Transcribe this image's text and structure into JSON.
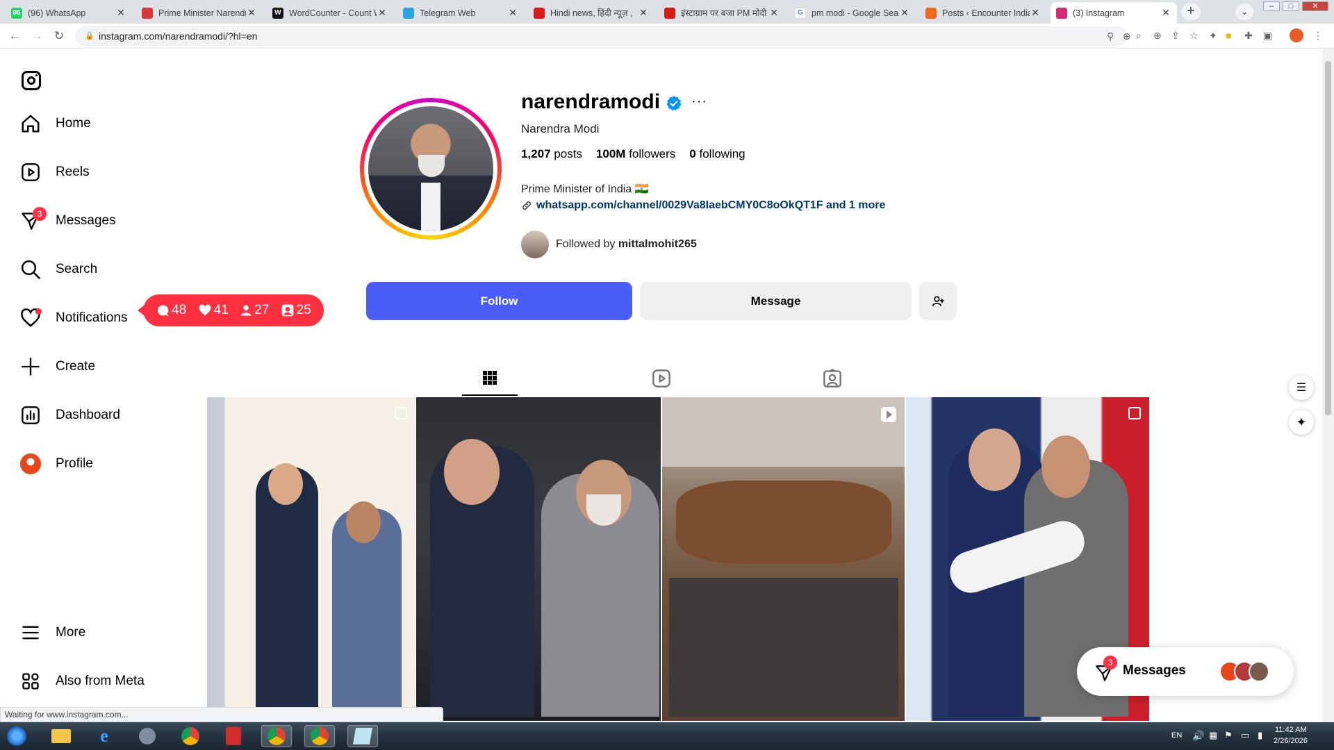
{
  "browser": {
    "tabs": [
      {
        "title": "(96) WhatsApp",
        "favicon": "whatsapp-icon",
        "color": "#25d366",
        "glyph": "96"
      },
      {
        "title": "Prime Minister Narendr",
        "favicon": "pmindia-icon",
        "color": "#d93636",
        "glyph": ""
      },
      {
        "title": "WordCounter - Count W",
        "favicon": "wordcounter-icon",
        "color": "#111111",
        "glyph": "W"
      },
      {
        "title": "Telegram Web",
        "favicon": "telegram-icon",
        "color": "#2aa3df",
        "glyph": ""
      },
      {
        "title": "Hindi news, हिंदी न्यूज़ ,",
        "favicon": "news-icon",
        "color": "#d71b1b",
        "glyph": ""
      },
      {
        "title": "इंस्टाग्राम पर बजा PM मोदी",
        "favicon": "news-icon",
        "color": "#d71b1b",
        "glyph": ""
      },
      {
        "title": "pm modi - Google Sear",
        "favicon": "google-icon",
        "color": "#ffffff",
        "glyph": "G"
      },
      {
        "title": "Posts ‹ Encounter India",
        "favicon": "encounter-icon",
        "color": "#f06a1e",
        "glyph": ""
      },
      {
        "title": "(3) Instagram",
        "favicon": "instagram-icon",
        "color": "#d62976",
        "glyph": ""
      }
    ],
    "url": "instagram.com/narendramodi/?hl=en",
    "status": "Waiting for www.instagram.com..."
  },
  "sidebar": {
    "items": [
      {
        "label": "Home",
        "icon": "home-icon"
      },
      {
        "label": "Reels",
        "icon": "reels-icon"
      },
      {
        "label": "Messages",
        "icon": "messages-icon",
        "badge": "3"
      },
      {
        "label": "Search",
        "icon": "search-icon"
      },
      {
        "label": "Notifications",
        "icon": "heart-icon"
      },
      {
        "label": "Create",
        "icon": "plus-icon"
      },
      {
        "label": "Dashboard",
        "icon": "dashboard-icon"
      },
      {
        "label": "Profile",
        "icon": "profile-avatar-icon"
      }
    ],
    "more": "More",
    "also_meta": "Also from Meta"
  },
  "notifications_pill": {
    "comments": "48",
    "likes": "41",
    "follows": "27",
    "tags": "25"
  },
  "profile": {
    "username": "narendramodi",
    "full_name": "Narendra Modi",
    "posts_count": "1,207",
    "posts_label": "posts",
    "followers_count": "100M",
    "followers_label": "followers",
    "following_count": "0",
    "following_label": "following",
    "bio": "Prime Minister of India 🇮🇳",
    "link": "whatsapp.com/channel/0029Va8IaebCMY0C8oOkQT1F and 1 more",
    "followed_by_prefix": "Followed by",
    "followed_by_user": "mittalmohit265",
    "follow_label": "Follow",
    "message_label": "Message",
    "accent": "#4a5df9"
  },
  "floating_messages": {
    "label": "Messages",
    "badge": "3"
  },
  "taskbar": {
    "lang": "EN",
    "time": "11:42 AM",
    "date": "2/26/2026"
  }
}
